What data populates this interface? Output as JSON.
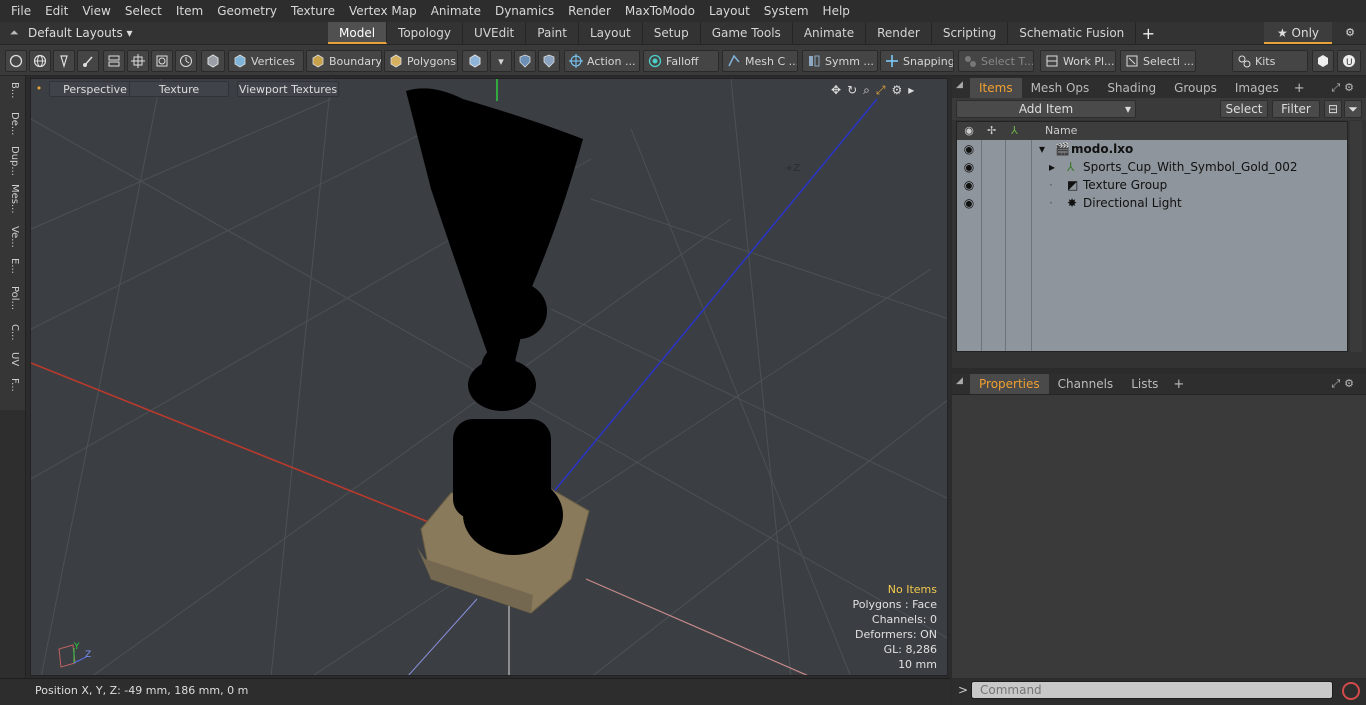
{
  "menu": [
    "File",
    "Edit",
    "View",
    "Select",
    "Item",
    "Geometry",
    "Texture",
    "Vertex Map",
    "Animate",
    "Dynamics",
    "Render",
    "MaxToModo",
    "Layout",
    "System",
    "Help"
  ],
  "layoutbar": {
    "layouts_label": "Default Layouts ▾",
    "tabs": [
      "Model",
      "Topology",
      "UVEdit",
      "Paint",
      "Layout",
      "Setup",
      "Game Tools",
      "Animate",
      "Render",
      "Scripting",
      "Schematic Fusion"
    ],
    "active_tab": "Model",
    "only_label": "★ Only"
  },
  "toolbar": {
    "vertices": "Vertices",
    "boundary": "Boundary",
    "polygons": "Polygons",
    "action": "Action ...",
    "falloff": "Falloff",
    "mesh_c": "Mesh C ...",
    "symm": "Symm ...",
    "snapping": "Snapping",
    "select_t": "Select T...",
    "work_pl": "Work Pl...",
    "selecti": "Selecti ...",
    "kits": "Kits"
  },
  "left_tabs": [
    "B...",
    "De...",
    "Dup...",
    "Mes...",
    "Ve...",
    "E...",
    "Pol...",
    "C...",
    "UV",
    "F..."
  ],
  "viewport": {
    "perspective": "Perspective",
    "texture": "Texture",
    "viewport_textures": "Viewport Textures",
    "axis_label": "+Z",
    "gizmo_y": "Y",
    "gizmo_z": "Z",
    "info": {
      "no_items": "No Items",
      "polygons": "Polygons : Face",
      "channels": "Channels: 0",
      "deformers": "Deformers: ON",
      "gl": "GL: 8,286",
      "scale": "10 mm"
    }
  },
  "status": {
    "position": "Position X, Y, Z:  -49 mm, 186 mm, 0 m"
  },
  "items_panel": {
    "tabs": [
      "Items",
      "Mesh Ops",
      "Shading",
      "Groups",
      "Images"
    ],
    "active_tab": "Items",
    "add_item": "Add Item",
    "select": "Select",
    "filter": "Filter",
    "name_header": "Name",
    "tree": [
      {
        "label": "modo.lxo",
        "depth": 0,
        "bold": true
      },
      {
        "label": "Sports_Cup_With_Symbol_Gold_002",
        "depth": 1,
        "bold": false
      },
      {
        "label": "Texture Group",
        "depth": 1,
        "bold": false
      },
      {
        "label": "Directional Light",
        "depth": 1,
        "bold": false
      }
    ]
  },
  "props_panel": {
    "tabs": [
      "Properties",
      "Channels",
      "Lists"
    ],
    "active_tab": "Properties"
  },
  "command": {
    "placeholder": "Command"
  },
  "colors": {
    "accent": "#e8a23a",
    "viewport_bg": "#3b3f43",
    "tree_bg": "#8f959c",
    "x_axis": "#c0392b",
    "y_axis": "#2ecc40",
    "z_axis": "#2a35c8"
  }
}
